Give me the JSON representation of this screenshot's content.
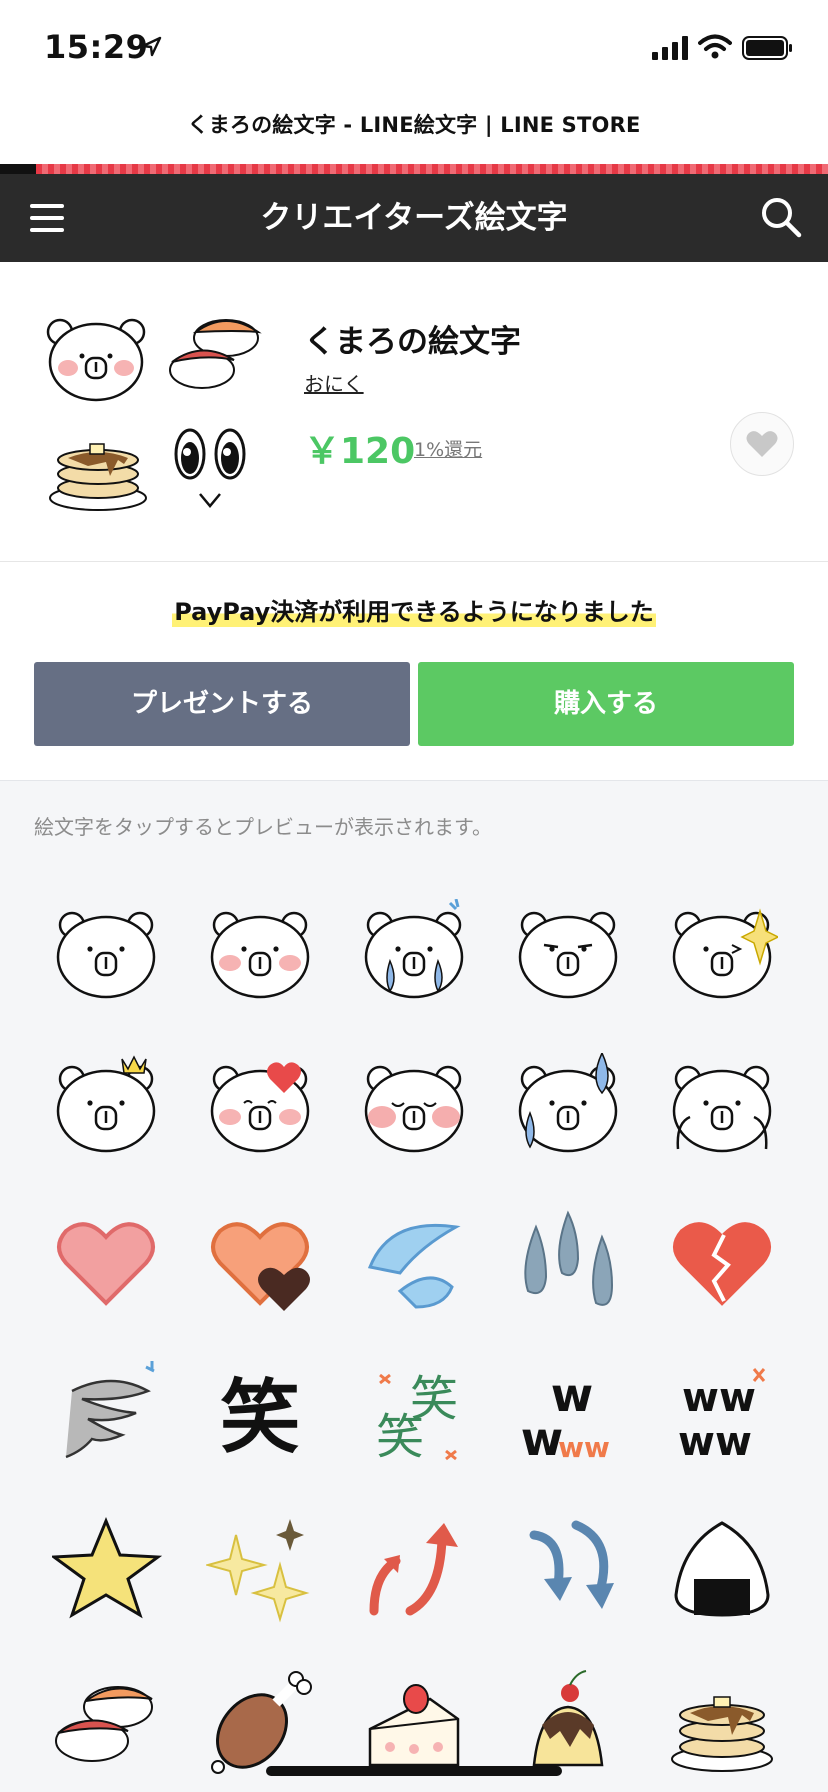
{
  "status_bar": {
    "time": "15:29"
  },
  "browser": {
    "page_title": "くまろの絵文字 - LINE絵文字 | LINE STORE"
  },
  "nav": {
    "title": "クリエイターズ絵文字"
  },
  "product": {
    "name": "くまろの絵文字",
    "author": "おにく",
    "price": "￥120",
    "reward": "1%還元"
  },
  "banner": {
    "paypay": "PayPay決済が利用できるようになりました"
  },
  "buttons": {
    "present": "プレゼントする",
    "buy": "購入する"
  },
  "preview": {
    "hint": "絵文字をタップするとプレビューが表示されます。",
    "emojis": [
      "bear-plain",
      "bear-blush",
      "bear-cry",
      "bear-grumpy",
      "bear-wink-sparkle",
      "bear-crown",
      "bear-heart",
      "bear-blush-smile",
      "bear-sweat",
      "bear-cover-cheeks",
      "heart-pink",
      "hearts-orange",
      "water-drops",
      "rain-drops",
      "broken-heart",
      "tornado",
      "warai-black",
      "warai-green",
      "www-black",
      "www-orange",
      "star",
      "sparkles",
      "arrows-up",
      "arrows-down",
      "onigiri",
      "sushi",
      "chicken-leg",
      "cake",
      "pudding",
      "pancakes"
    ]
  },
  "colors": {
    "accent_green": "#4cc764",
    "nav_bg": "#2b2b2b",
    "present_btn": "#666f84",
    "buy_btn": "#5cc963"
  }
}
